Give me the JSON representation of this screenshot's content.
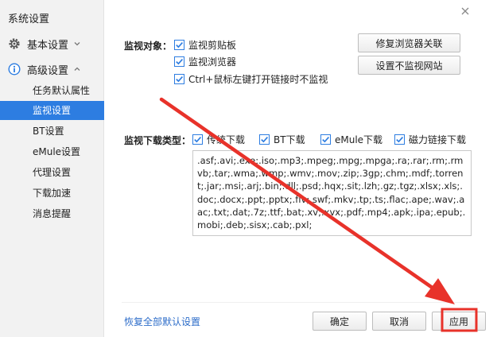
{
  "sidebar": {
    "title": "系统设置",
    "groups": [
      {
        "label": "基本设置"
      },
      {
        "label": "高级设置"
      }
    ],
    "items": [
      {
        "label": "任务默认属性"
      },
      {
        "label": "监视设置"
      },
      {
        "label": "BT设置"
      },
      {
        "label": "eMule设置"
      },
      {
        "label": "代理设置"
      },
      {
        "label": "下载加速"
      },
      {
        "label": "消息提醒"
      }
    ]
  },
  "monitor_objects": {
    "label": "监视对象：",
    "options": [
      {
        "label": "监视剪贴板",
        "checked": true
      },
      {
        "label": "监视浏览器",
        "checked": true
      },
      {
        "label": "Ctrl+鼠标左键打开链接时不监视",
        "checked": true
      }
    ],
    "buttons": {
      "repair_browser": "修复浏览器关联",
      "unmonitored_sites": "设置不监视网站"
    }
  },
  "monitor_types": {
    "label": "监视下载类型：",
    "options": [
      {
        "label": "传统下载",
        "checked": true
      },
      {
        "label": "BT下载",
        "checked": true
      },
      {
        "label": "eMule下载",
        "checked": true
      },
      {
        "label": "磁力链接下载",
        "checked": true
      }
    ],
    "extensions": ".asf;.avi;.exe;.iso;.mp3;.mpeg;.mpg;.mpga;.ra;.rar;.rm;.rmvb;.tar;.wma;.wmp;.wmv;.mov;.zip;.3gp;.chm;.mdf;.torrent;.jar;.msi;.arj;.bin;.dll;.psd;.hqx;.sit;.lzh;.gz;.tgz;.xlsx;.xls;.doc;.docx;.ppt;.pptx;.flv;.swf;.mkv;.tp;.ts;.flac;.ape;.wav;.aac;.txt;.dat;.7z;.ttf;.bat;.xv;.xvx;.pdf;.mp4;.apk;.ipa;.epub;.mobi;.deb;.sisx;.cab;.pxl;"
  },
  "footer": {
    "restore_defaults": "恢复全部默认设置",
    "ok": "确定",
    "cancel": "取消",
    "apply": "应用"
  },
  "colors": {
    "accent": "#2d7de1",
    "annotation": "#e8322a"
  }
}
